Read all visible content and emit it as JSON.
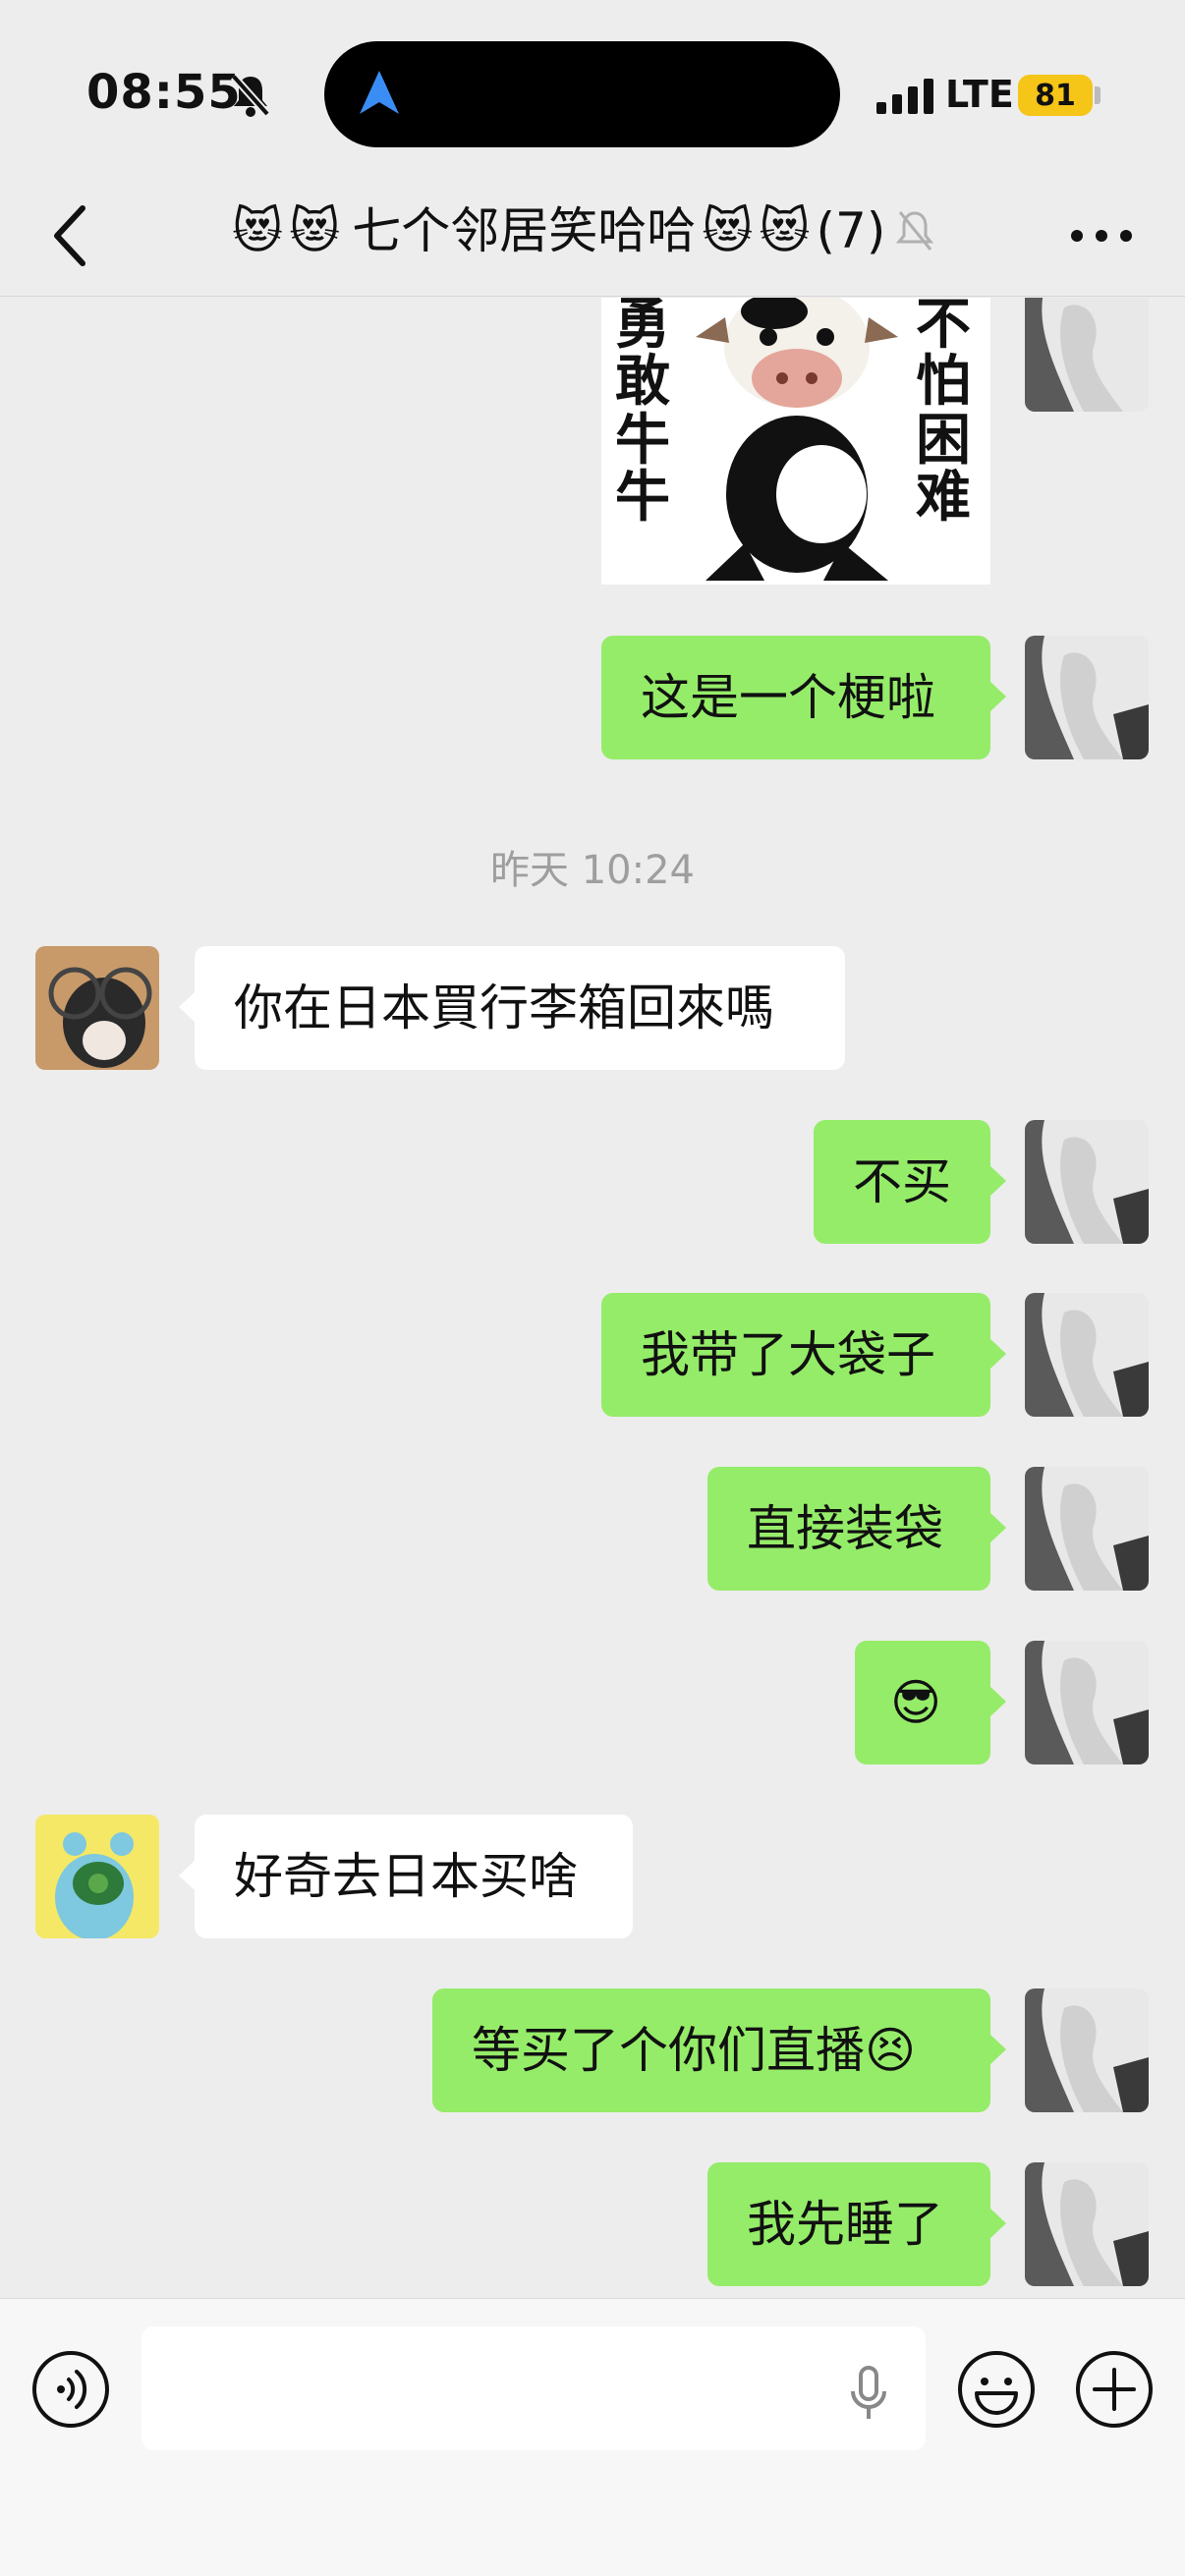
{
  "status_bar": {
    "time": "08:55",
    "network": "LTE",
    "battery": "81"
  },
  "header": {
    "title_emoji": "😻",
    "title_text": "七个邻居笑哈哈",
    "member_count": "(7)"
  },
  "sticker": {
    "left_text": [
      "勇",
      "敢",
      "牛",
      "牛"
    ],
    "right_text": [
      "不",
      "怕",
      "困",
      "难"
    ]
  },
  "messages": {
    "m1": "这是一个梗啦",
    "timestamp": "昨天 10:24",
    "m2": "你在日本買行李箱回來嗎",
    "m3": "不买",
    "m4": "我带了大袋子",
    "m5": "直接装袋",
    "m6": "😎",
    "m7": "好奇去日本买啥",
    "m8": "等买了个你们直播😣",
    "m9": "我先睡了"
  },
  "input": {
    "placeholder": ""
  },
  "colors": {
    "outgoing_bubble": "#95ec69",
    "incoming_bubble": "#ffffff",
    "background": "#ededed"
  }
}
